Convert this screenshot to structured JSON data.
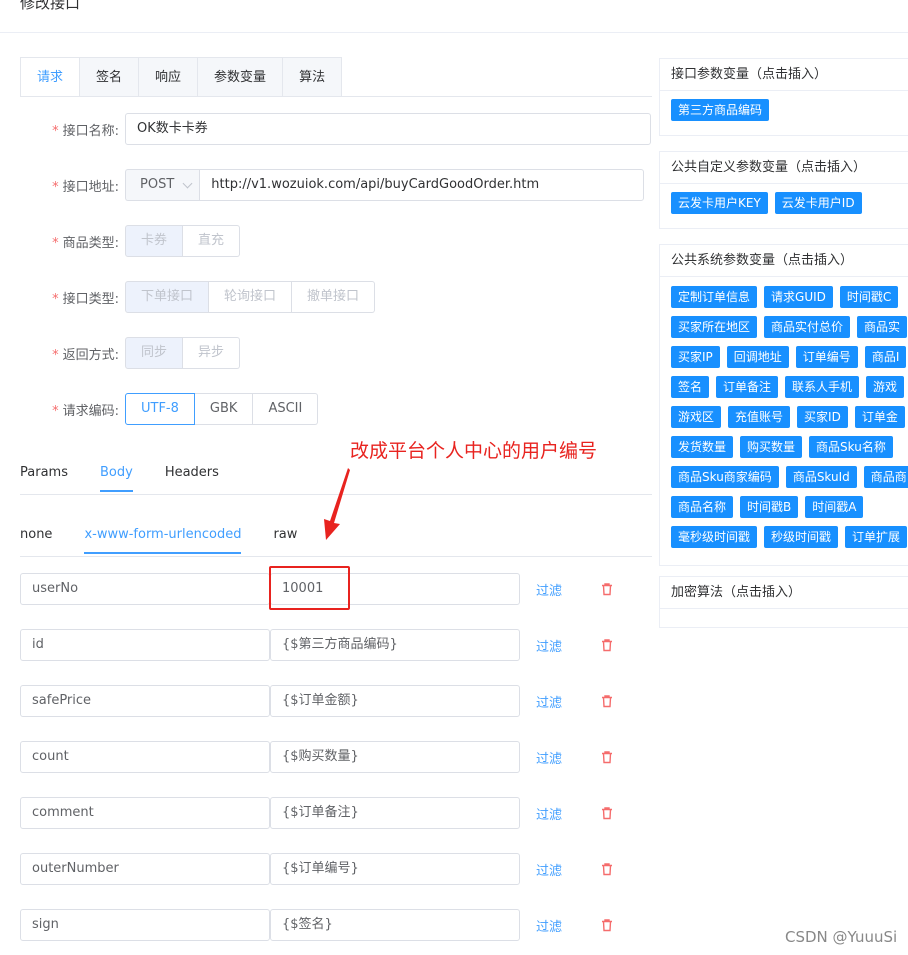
{
  "page_title": "修改接口",
  "tabs": [
    {
      "label": "请求",
      "active": true
    },
    {
      "label": "签名"
    },
    {
      "label": "响应"
    },
    {
      "label": "参数变量"
    },
    {
      "label": "算法"
    }
  ],
  "form": {
    "name_label": "接口名称:",
    "name_value": "OK数卡卡券",
    "address_label": "接口地址:",
    "method_value": "POST",
    "url_value": "http://v1.wozuiok.com/api/buyCardGoodOrder.htm",
    "goods_type_label": "商品类型:",
    "goods_type_options": [
      "卡券",
      "直充"
    ],
    "api_type_label": "接口类型:",
    "api_type_options": [
      "下单接口",
      "轮询接口",
      "撤单接口"
    ],
    "return_label": "返回方式:",
    "return_options": [
      "同步",
      "异步"
    ],
    "encoding_label": "请求编码:",
    "encoding_options": [
      "UTF-8",
      "GBK",
      "ASCII"
    ]
  },
  "sub_tabs": [
    "Params",
    "Body",
    "Headers"
  ],
  "body_types": [
    "none",
    "x-www-form-urlencoded",
    "raw"
  ],
  "params": [
    {
      "key": "userNo",
      "value": "10001"
    },
    {
      "key": "id",
      "value": "{$第三方商品编码}"
    },
    {
      "key": "safePrice",
      "value": "{$订单金额}"
    },
    {
      "key": "count",
      "value": "{$购买数量}"
    },
    {
      "key": "comment",
      "value": "{$订单备注}"
    },
    {
      "key": "outerNumber",
      "value": "{$订单编号}"
    },
    {
      "key": "sign",
      "value": "{$签名}"
    }
  ],
  "filter_label": "过滤",
  "annotation": "改成平台个人中心的用户编号",
  "panels": {
    "api_params_title": "接口参数变量（点击插入）",
    "api_params_tags": [
      "第三方商品编码"
    ],
    "custom_title": "公共自定义参数变量（点击插入）",
    "custom_tags": [
      "云发卡用户KEY",
      "云发卡用户ID"
    ],
    "system_title": "公共系统参数变量（点击插入）",
    "system_tag_rows": [
      [
        "定制订单信息",
        "请求GUID",
        "时间戳C"
      ],
      [
        "买家所在地区",
        "商品实付总价",
        "商品实"
      ],
      [
        "买家IP",
        "回调地址",
        "订单编号",
        "商品I"
      ],
      [
        "签名",
        "订单备注",
        "联系人手机",
        "游戏"
      ],
      [
        "游戏区",
        "充值账号",
        "买家ID",
        "订单金"
      ],
      [
        "发货数量",
        "购买数量",
        "商品Sku名称"
      ],
      [
        "商品Sku商家编码",
        "商品SkuId",
        "商品商"
      ],
      [
        "商品名称",
        "时间戳B",
        "时间戳A"
      ],
      [
        "毫秒级时间戳",
        "秒级时间戳",
        "订单扩展"
      ]
    ],
    "encrypt_title": "加密算法（点击插入）"
  },
  "colors": {
    "accent": "#409eff",
    "tag": "#1890ff",
    "annotation": "#e8231f",
    "danger": "#f56c6c"
  },
  "watermark": "CSDN @YuuuSi"
}
